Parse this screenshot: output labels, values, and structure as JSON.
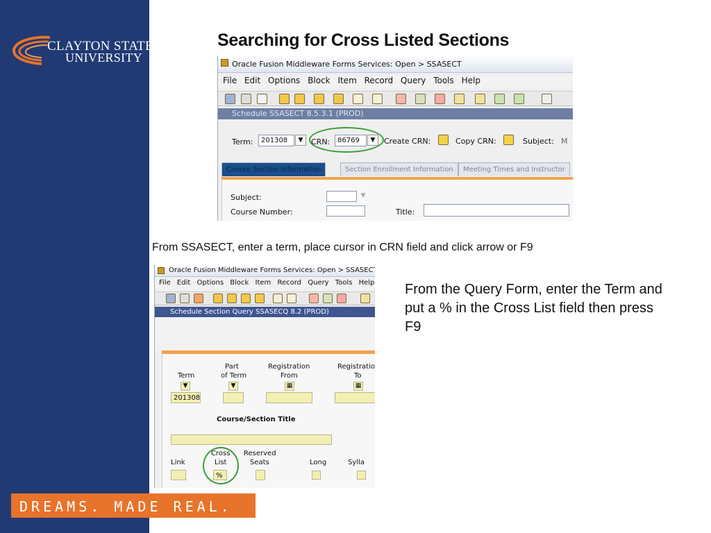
{
  "branding": {
    "logo_line1": "CLAYTON STATE",
    "logo_line2": "UNIVERSITY",
    "tagline": "DREAMS. MADE REAL.",
    "colors": {
      "navy": "#213a74",
      "orange": "#e8732a",
      "highlight": "#3a9e3a"
    }
  },
  "slide": {
    "title": "Searching for Cross Listed Sections",
    "caption_step1": "From SSASECT, enter a term, place cursor in CRN field and click arrow or F9",
    "caption_step2": "From the Query Form, enter the Term and put a % in the Cross List field then press F9"
  },
  "screenshot1": {
    "window_title": "Oracle Fusion Middleware Forms Services:  Open > SSASECT",
    "menu": [
      "File",
      "Edit",
      "Options",
      "Block",
      "Item",
      "Record",
      "Query",
      "Tools",
      "Help"
    ],
    "form_title": "Schedule  SSASECT  8.5.3.1  (PROD)",
    "key_block": {
      "term_label": "Term:",
      "term_value": "201308",
      "crn_label": "CRN:",
      "crn_value": "86769",
      "create_crn_label": "Create CRN:",
      "copy_crn_label": "Copy CRN:",
      "subject_label": "Subject:",
      "subject_value": "M"
    },
    "tabs": [
      "Course Section Information",
      "Section Enrollment Information",
      "Meeting Times and Instructor"
    ],
    "fields": {
      "subject_label": "Subject:",
      "course_number_label": "Course Number:",
      "title_label": "Title:"
    }
  },
  "screenshot2": {
    "window_title": "Oracle Fusion Middleware Forms Services:  Open > SSASECT - SSASE",
    "menu": [
      "File",
      "Edit",
      "Options",
      "Block",
      "Item",
      "Record",
      "Query",
      "Tools",
      "Help"
    ],
    "form_title": "Schedule Section Query  SSASECQ  8.2  (PROD)",
    "columns": {
      "term": "Term",
      "part_of_term_1": "Part",
      "part_of_term_2": "of Term",
      "reg_from_1": "Registration",
      "reg_from_2": "From",
      "reg_to_1": "Registratio",
      "reg_to_2": "To"
    },
    "term_value": "201308",
    "course_section_title_label": "Course/Section Title",
    "bottom_labels": {
      "link": "Link",
      "cross_1": "Cross",
      "cross_2": "List",
      "reserved_1": "Reserved",
      "reserved_2": "Seats",
      "long": "Long",
      "syllabus": "Sylla"
    },
    "cross_list_value": "%"
  }
}
